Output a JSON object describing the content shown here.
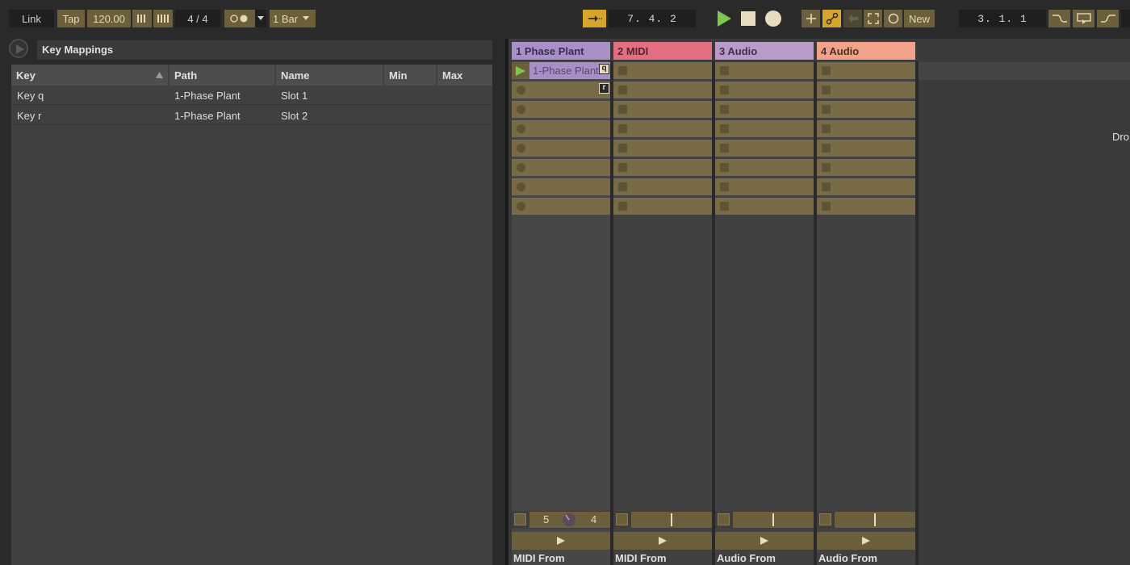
{
  "toolbar": {
    "link": "Link",
    "tap": "Tap",
    "tempo": "120.00",
    "time_signature": "4 / 4",
    "quantize": "1 Bar",
    "arrangement_position": "7.  4.  2",
    "new_label": "New",
    "loop_start": "3.  1.  1"
  },
  "key_mappings": {
    "title": "Key Mappings",
    "columns": [
      "Key",
      "Path",
      "Name",
      "Min",
      "Max"
    ],
    "rows": [
      {
        "key": "Key q",
        "path": "1-Phase Plant",
        "name": "Slot 1",
        "min": "",
        "max": ""
      },
      {
        "key": "Key r",
        "path": "1-Phase Plant",
        "name": "Slot 2",
        "min": "",
        "max": ""
      }
    ]
  },
  "session": {
    "tracks": [
      {
        "name": "1 Phase Plant",
        "color": "#a98fc7",
        "io": "MIDI From"
      },
      {
        "name": "2 MIDI",
        "color": "#e46f80",
        "io": "MIDI From"
      },
      {
        "name": "3 Audio",
        "color": "#b99ac8",
        "io": "Audio From"
      },
      {
        "name": "4 Audio",
        "color": "#f2a28a",
        "io": "Audio From"
      }
    ],
    "clip_name": "1-Phase Plant",
    "clip_key_q": "q",
    "clip_key_r": "r",
    "track1_controls": {
      "left": "5",
      "right": "4"
    },
    "drop_hint": "Dro"
  },
  "colors": {
    "accent": "#d8a52c",
    "slot": "#7a6b47",
    "play_green": "#7ac94e"
  }
}
